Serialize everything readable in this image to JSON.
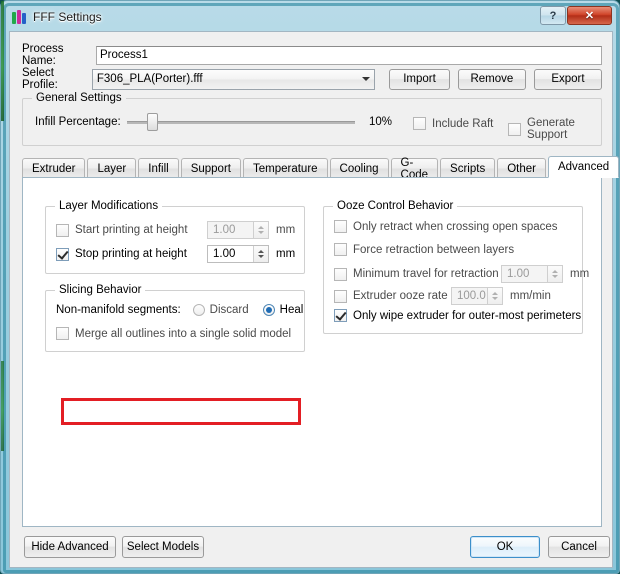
{
  "window": {
    "title": "FFF Settings",
    "icon": "fff-logo-icon",
    "help_label": "?",
    "close_label": "✕"
  },
  "form": {
    "process_name_label": "Process Name:",
    "process_name_value": "Process1",
    "select_profile_label": "Select Profile:",
    "selected_profile": "F306_PLA(Porter).fff",
    "import_label": "Import",
    "remove_label": "Remove",
    "export_label": "Export"
  },
  "general_settings": {
    "title": "General Settings",
    "infill_label": "Infill Percentage:",
    "infill_value": "10%",
    "infill_percent": 10,
    "include_raft_label": "Include Raft",
    "include_raft_checked": false,
    "generate_support_label": "Generate Support",
    "generate_support_checked": false
  },
  "tabs": [
    {
      "label": "Extruder",
      "active": false
    },
    {
      "label": "Layer",
      "active": false
    },
    {
      "label": "Infill",
      "active": false
    },
    {
      "label": "Support",
      "active": false
    },
    {
      "label": "Temperature",
      "active": false
    },
    {
      "label": "Cooling",
      "active": false
    },
    {
      "label": "G-Code",
      "active": false
    },
    {
      "label": "Scripts",
      "active": false
    },
    {
      "label": "Other",
      "active": false
    },
    {
      "label": "Advanced",
      "active": true
    }
  ],
  "layer_modifications": {
    "title": "Layer Modifications",
    "start_label": "Start printing at height",
    "start_checked": false,
    "start_value": "1.00",
    "start_unit": "mm",
    "stop_label": "Stop printing at height",
    "stop_checked": true,
    "stop_value": "1.00",
    "stop_unit": "mm"
  },
  "slicing_behavior": {
    "title": "Slicing Behavior",
    "nonmanifold_label": "Non-manifold segments:",
    "discard_label": "Discard",
    "discard_selected": false,
    "heal_label": "Heal",
    "heal_selected": true,
    "merge_label": "Merge all outlines into a single solid model",
    "merge_checked": false
  },
  "ooze_control": {
    "title": "Ooze Control Behavior",
    "only_retract_label": "Only retract when crossing open spaces",
    "only_retract_checked": false,
    "force_retraction_label": "Force retraction between layers",
    "force_retraction_checked": false,
    "min_travel_label": "Minimum travel for retraction",
    "min_travel_checked": false,
    "min_travel_value": "1.00",
    "min_travel_unit": "mm",
    "ooze_rate_label": "Extruder ooze rate",
    "ooze_rate_checked": false,
    "ooze_rate_value": "100.0",
    "ooze_rate_unit": "mm/min",
    "only_wipe_label": "Only wipe extruder for outer-most perimeters",
    "only_wipe_checked": true
  },
  "footer": {
    "hide_advanced_label": "Hide Advanced",
    "select_models_label": "Select Models",
    "ok_label": "OK",
    "cancel_label": "Cancel"
  },
  "annotation": {
    "highlight_color": "#e31e24",
    "highlight_target": "stop-printing-at-height-row"
  }
}
